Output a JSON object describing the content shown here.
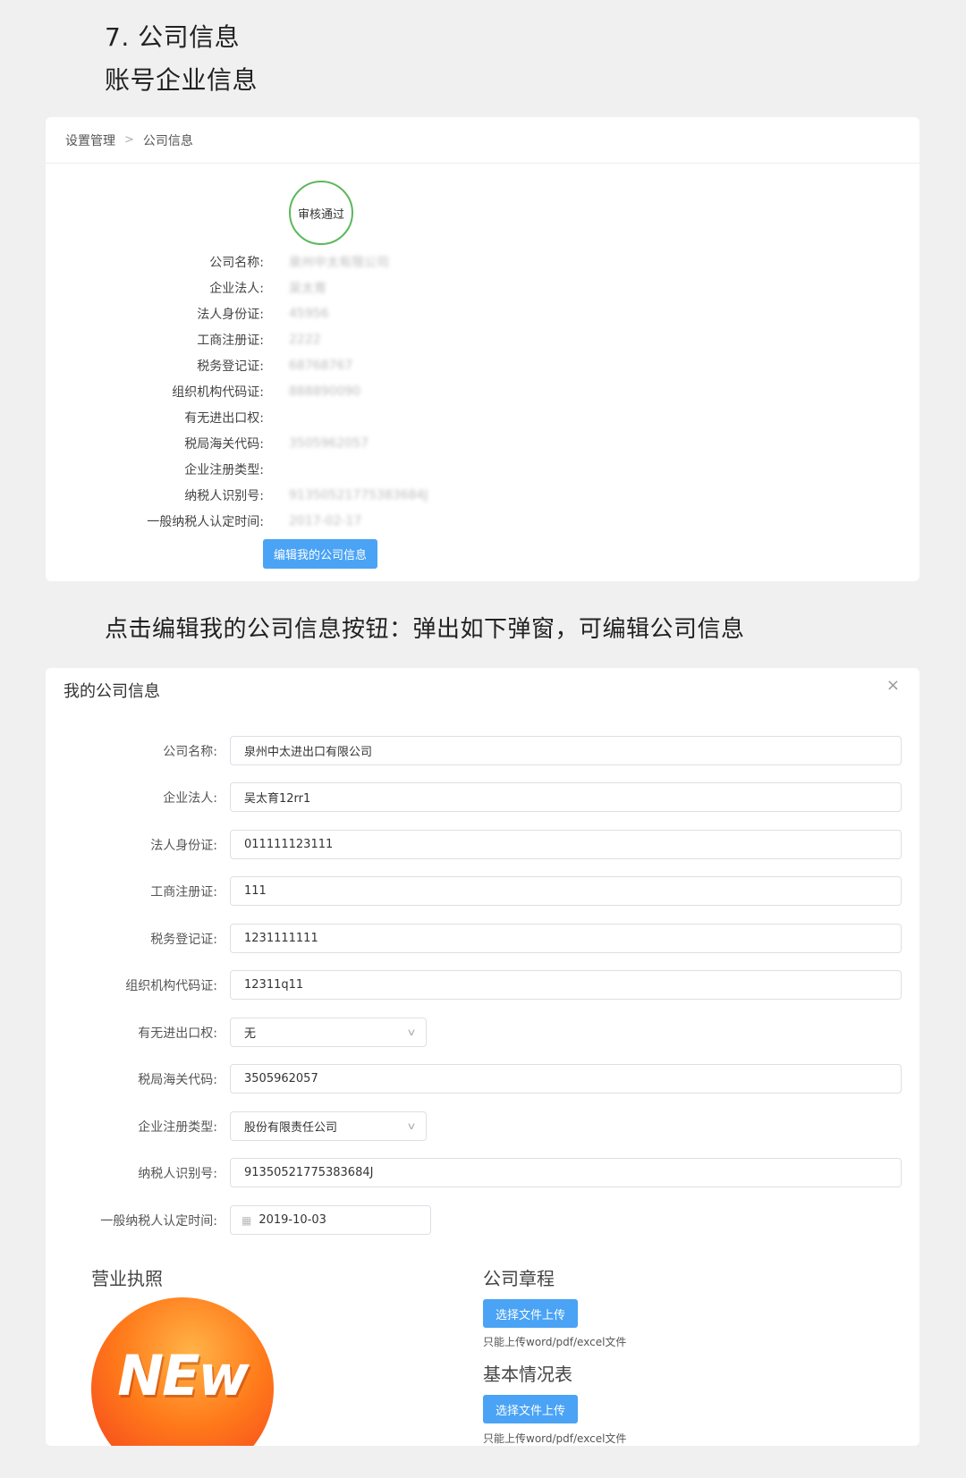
{
  "doc": {
    "heading1": "7. 公司信息",
    "heading2": "账号企业信息",
    "heading3": "点击编辑我的公司信息按钮：弹出如下弹窗，可编辑公司信息"
  },
  "page": {
    "breadcrumb": [
      "设置管理",
      "公司信息"
    ],
    "breadcrumb_sep": ">",
    "status_badge": "审核通过",
    "info_rows": [
      {
        "label": "公司名称:",
        "value": "泉州中太有限公司"
      },
      {
        "label": "企业法人:",
        "value": "吴太育"
      },
      {
        "label": "法人身份证:",
        "value": "45956"
      },
      {
        "label": "工商注册证:",
        "value": "2222"
      },
      {
        "label": "税务登记证:",
        "value": "68768767"
      },
      {
        "label": "组织机构代码证:",
        "value": "888890090"
      },
      {
        "label": "有无进出口权:",
        "value": ""
      },
      {
        "label": "税局海关代码:",
        "value": "3505962057"
      },
      {
        "label": "企业注册类型:",
        "value": ""
      },
      {
        "label": "纳税人识别号:",
        "value": "91350521775383684J"
      },
      {
        "label": "一般纳税人认定时间:",
        "value": "2017-02-17"
      }
    ],
    "edit_button": "编辑我的公司信息"
  },
  "modal": {
    "title": "我的公司信息",
    "close_icon": "×",
    "fields": [
      {
        "label": "公司名称:",
        "value": "泉州中太进出口有限公司"
      },
      {
        "label": "企业法人:",
        "value": "吴太育12rr1"
      },
      {
        "label": "法人身份证:",
        "value": "011111123111"
      },
      {
        "label": "工商注册证:",
        "value": "111"
      },
      {
        "label": "税务登记证:",
        "value": "1231111111"
      },
      {
        "label": "组织机构代码证:",
        "value": "12311q11"
      },
      {
        "label": "有无进出口权:",
        "value": "无"
      },
      {
        "label": "税局海关代码:",
        "value": "3505962057"
      },
      {
        "label": "企业注册类型:",
        "value": "股份有限责任公司"
      },
      {
        "label": "纳税人识别号:",
        "value": "91350521775383684J"
      },
      {
        "label": "一般纳税人认定时间:",
        "value": "2019-10-03"
      }
    ],
    "license_title": "营业执照",
    "license_logo_text": "NEw",
    "charter_title": "公司章程",
    "charter_upload": "选择文件上传",
    "charter_hint": "只能上传word/pdf/excel文件",
    "basic_title": "基本情况表",
    "basic_upload": "选择文件上传",
    "basic_hint": "只能上传word/pdf/excel文件"
  },
  "icons": {
    "chevron": "chevron-down-icon",
    "calendar": "calendar-icon",
    "close": "close-icon"
  },
  "colors": {
    "primary": "#4aa3f5",
    "badge_border": "#5cb85c",
    "background": "#f0f0f1"
  }
}
